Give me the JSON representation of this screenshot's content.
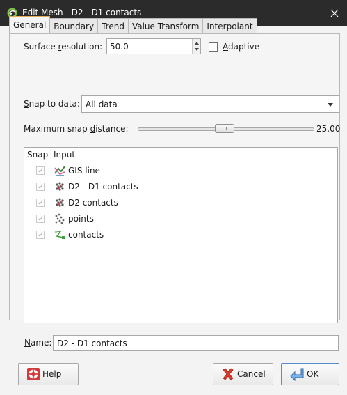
{
  "window": {
    "title": "Edit Mesh - D2 - D1 contacts",
    "accent_color": "#e0ae58",
    "titlebar_color": "#2b2b2b"
  },
  "tabs": [
    {
      "label": "General",
      "active": true
    },
    {
      "label": "Boundary",
      "active": false
    },
    {
      "label": "Trend",
      "active": false
    },
    {
      "label": "Value Transform",
      "active": false
    },
    {
      "label": "Interpolant",
      "active": false
    }
  ],
  "surface_resolution": {
    "label_before": "Surface ",
    "label_mnemonic": "r",
    "label_after": "esolution:",
    "value": "50.0"
  },
  "adaptive": {
    "label_mnemonic": "A",
    "label_rest": "daptive",
    "checked": false
  },
  "snap_to_data": {
    "label_mnemonic": "S",
    "label_rest": "nap to data:",
    "selected": "All data"
  },
  "max_snap_distance": {
    "label_before": "Maximum snap ",
    "label_mnemonic": "d",
    "label_after": "istance:",
    "value_text": "25.00",
    "position_fraction": 0.48
  },
  "inputs_list": {
    "col_snap": "Snap",
    "col_input": "Input",
    "rows": [
      {
        "label": "GIS line",
        "icon": "gis-line-icon",
        "checked": true
      },
      {
        "label": "D2 - D1 contacts",
        "icon": "points-cluster-icon",
        "checked": true
      },
      {
        "label": "D2 contacts",
        "icon": "points-cluster-icon",
        "checked": true
      },
      {
        "label": "points",
        "icon": "points-scatter-icon",
        "checked": true
      },
      {
        "label": "contacts",
        "icon": "contacts-polyline-icon",
        "checked": true
      }
    ]
  },
  "name_field": {
    "label_mnemonic": "N",
    "label_rest": "ame:",
    "value": "D2 - D1 contacts"
  },
  "buttons": {
    "help_mnemonic": "H",
    "help_rest": "elp",
    "cancel_mnemonic": "C",
    "cancel_rest": "ancel",
    "ok_mnemonic": "O",
    "ok_rest": "K"
  }
}
